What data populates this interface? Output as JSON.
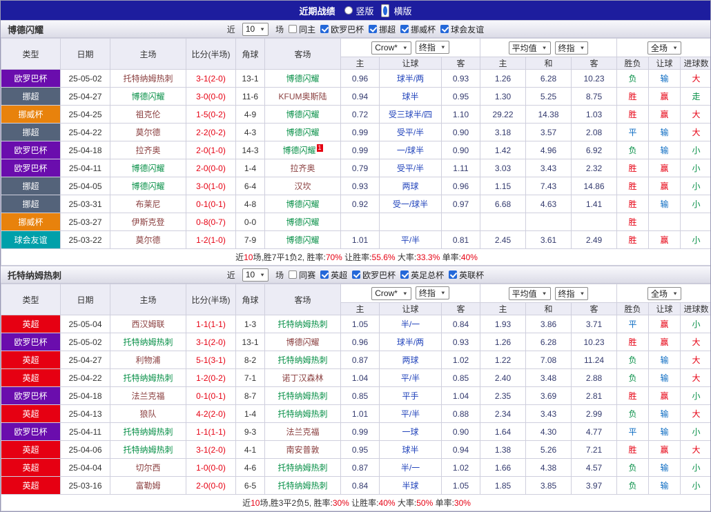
{
  "topbar": {
    "title": "近期战绩",
    "view_options": [
      {
        "label": "竖版",
        "selected": false
      },
      {
        "label": "横版",
        "selected": true
      }
    ]
  },
  "filter_labels": {
    "near": "近",
    "games": "场"
  },
  "table_header": {
    "static_cols": [
      "类型",
      "日期",
      "主场",
      "比分(半场)",
      "角球",
      "客场"
    ],
    "group1": {
      "selects": [
        "Crow*",
        "终指"
      ],
      "cols": [
        "主",
        "让球",
        "客"
      ]
    },
    "group2": {
      "selects": [
        "平均值",
        "终指"
      ],
      "cols": [
        "主",
        "和",
        "客"
      ]
    },
    "group3": {
      "selects": [
        "全场"
      ],
      "cols": [
        "胜负",
        "让球",
        "进球数"
      ]
    }
  },
  "league_colors": {
    "欧罗巴杯": "#6a0dad",
    "挪超": "#54637a",
    "挪威杯": "#e8820c",
    "球会友谊": "#00a0aa",
    "英超": "#e60012"
  },
  "sections": [
    {
      "team": "博德闪耀",
      "filter": {
        "count": "10",
        "same": {
          "label": "同主",
          "checked": false
        },
        "leagues": [
          {
            "label": "欧罗巴杯",
            "checked": true
          },
          {
            "label": "挪超",
            "checked": true
          },
          {
            "label": "挪威杯",
            "checked": true
          },
          {
            "label": "球会友谊",
            "checked": true
          }
        ]
      },
      "rows": [
        {
          "league": "欧罗巴杯",
          "date": "25-05-02",
          "home": {
            "name": "托特纳姆热刺",
            "focus": false
          },
          "score": "3-1(2-0)",
          "corners": "13-1",
          "away": {
            "name": "博德闪耀",
            "focus": true
          },
          "crow": [
            "0.96",
            "球半/两",
            "0.93"
          ],
          "avg": [
            "1.26",
            "6.28",
            "10.23"
          ],
          "outcome": [
            {
              "t": "负",
              "c": "g"
            },
            {
              "t": "输",
              "c": "b"
            },
            {
              "t": "大",
              "c": "r"
            }
          ]
        },
        {
          "league": "挪超",
          "date": "25-04-27",
          "home": {
            "name": "博德闪耀",
            "focus": true
          },
          "score": "3-0(0-0)",
          "corners": "11-6",
          "away": {
            "name": "KFUM奥斯陆",
            "focus": false
          },
          "crow": [
            "0.94",
            "球半",
            "0.95"
          ],
          "avg": [
            "1.30",
            "5.25",
            "8.75"
          ],
          "outcome": [
            {
              "t": "胜",
              "c": "r"
            },
            {
              "t": "赢",
              "c": "r"
            },
            {
              "t": "走",
              "c": "g"
            }
          ]
        },
        {
          "league": "挪威杯",
          "date": "25-04-25",
          "home": {
            "name": "祖克伦",
            "focus": false
          },
          "score": "1-5(0-2)",
          "corners": "4-9",
          "away": {
            "name": "博德闪耀",
            "focus": true
          },
          "crow": [
            "0.72",
            "受三球半/四",
            "1.10"
          ],
          "avg": [
            "29.22",
            "14.38",
            "1.03"
          ],
          "outcome": [
            {
              "t": "胜",
              "c": "r"
            },
            {
              "t": "赢",
              "c": "r"
            },
            {
              "t": "大",
              "c": "r"
            }
          ]
        },
        {
          "league": "挪超",
          "date": "25-04-22",
          "home": {
            "name": "莫尔德",
            "focus": false
          },
          "score": "2-2(0-2)",
          "corners": "4-3",
          "away": {
            "name": "博德闪耀",
            "focus": true
          },
          "crow": [
            "0.99",
            "受平/半",
            "0.90"
          ],
          "avg": [
            "3.18",
            "3.57",
            "2.08"
          ],
          "outcome": [
            {
              "t": "平",
              "c": "b"
            },
            {
              "t": "输",
              "c": "b"
            },
            {
              "t": "大",
              "c": "r"
            }
          ]
        },
        {
          "league": "欧罗巴杯",
          "date": "25-04-18",
          "home": {
            "name": "拉齐奥",
            "focus": false
          },
          "score": "2-0(1-0)",
          "corners": "14-3",
          "away": {
            "name": "博德闪耀",
            "focus": true,
            "badge": "1"
          },
          "crow": [
            "0.99",
            "一/球半",
            "0.90"
          ],
          "avg": [
            "1.42",
            "4.96",
            "6.92"
          ],
          "outcome": [
            {
              "t": "负",
              "c": "g"
            },
            {
              "t": "输",
              "c": "b"
            },
            {
              "t": "小",
              "c": "g"
            }
          ]
        },
        {
          "league": "欧罗巴杯",
          "date": "25-04-11",
          "home": {
            "name": "博德闪耀",
            "focus": true
          },
          "score": "2-0(0-0)",
          "corners": "1-4",
          "away": {
            "name": "拉齐奥",
            "focus": false
          },
          "crow": [
            "0.79",
            "受平/半",
            "1.11"
          ],
          "avg": [
            "3.03",
            "3.43",
            "2.32"
          ],
          "outcome": [
            {
              "t": "胜",
              "c": "r"
            },
            {
              "t": "赢",
              "c": "r"
            },
            {
              "t": "小",
              "c": "g"
            }
          ]
        },
        {
          "league": "挪超",
          "date": "25-04-05",
          "home": {
            "name": "博德闪耀",
            "focus": true
          },
          "score": "3-0(1-0)",
          "corners": "6-4",
          "away": {
            "name": "汉坎",
            "focus": false
          },
          "crow": [
            "0.93",
            "两球",
            "0.96"
          ],
          "avg": [
            "1.15",
            "7.43",
            "14.86"
          ],
          "outcome": [
            {
              "t": "胜",
              "c": "r"
            },
            {
              "t": "赢",
              "c": "r"
            },
            {
              "t": "小",
              "c": "g"
            }
          ]
        },
        {
          "league": "挪超",
          "date": "25-03-31",
          "home": {
            "name": "布莱尼",
            "focus": false
          },
          "score": "0-1(0-1)",
          "corners": "4-8",
          "away": {
            "name": "博德闪耀",
            "focus": true
          },
          "crow": [
            "0.92",
            "受一/球半",
            "0.97"
          ],
          "avg": [
            "6.68",
            "4.63",
            "1.41"
          ],
          "outcome": [
            {
              "t": "胜",
              "c": "r"
            },
            {
              "t": "输",
              "c": "b"
            },
            {
              "t": "小",
              "c": "g"
            }
          ]
        },
        {
          "league": "挪威杯",
          "date": "25-03-27",
          "home": {
            "name": "伊斯克登",
            "focus": false
          },
          "score": "0-8(0-7)",
          "corners": "0-0",
          "away": {
            "name": "博德闪耀",
            "focus": true
          },
          "crow": [
            "",
            "",
            ""
          ],
          "avg": [
            "",
            "",
            ""
          ],
          "outcome": [
            {
              "t": "胜",
              "c": "r"
            },
            {
              "t": "",
              "c": "b"
            },
            {
              "t": "",
              "c": "g"
            }
          ]
        },
        {
          "league": "球会友谊",
          "date": "25-03-22",
          "home": {
            "name": "莫尔德",
            "focus": false
          },
          "score": "1-2(1-0)",
          "corners": "7-9",
          "away": {
            "name": "博德闪耀",
            "focus": true
          },
          "crow": [
            "1.01",
            "平/半",
            "0.81"
          ],
          "avg": [
            "2.45",
            "3.61",
            "2.49"
          ],
          "outcome": [
            {
              "t": "胜",
              "c": "r"
            },
            {
              "t": "赢",
              "c": "r"
            },
            {
              "t": "小",
              "c": "g"
            }
          ]
        }
      ],
      "summary": [
        {
          "t": "近",
          "c": "d"
        },
        {
          "t": "10",
          "c": "r"
        },
        {
          "t": "场,胜7平1负2, 胜率:",
          "c": "d"
        },
        {
          "t": "70%",
          "c": "r"
        },
        {
          "t": " 让胜率:",
          "c": "d"
        },
        {
          "t": "55.6%",
          "c": "r"
        },
        {
          "t": " 大率:",
          "c": "d"
        },
        {
          "t": "33.3%",
          "c": "r"
        },
        {
          "t": " 单率:",
          "c": "d"
        },
        {
          "t": "40%",
          "c": "r"
        }
      ]
    },
    {
      "team": "托特纳姆热刺",
      "filter": {
        "count": "10",
        "same": {
          "label": "同赛",
          "checked": false
        },
        "leagues": [
          {
            "label": "英超",
            "checked": true
          },
          {
            "label": "欧罗巴杯",
            "checked": true
          },
          {
            "label": "英足总杯",
            "checked": true
          },
          {
            "label": "英联杯",
            "checked": true
          }
        ]
      },
      "rows": [
        {
          "league": "英超",
          "date": "25-05-04",
          "home": {
            "name": "西汉姆联",
            "focus": false
          },
          "score": "1-1(1-1)",
          "corners": "1-3",
          "away": {
            "name": "托特纳姆热刺",
            "focus": true
          },
          "crow": [
            "1.05",
            "半/一",
            "0.84"
          ],
          "avg": [
            "1.93",
            "3.86",
            "3.71"
          ],
          "outcome": [
            {
              "t": "平",
              "c": "b"
            },
            {
              "t": "赢",
              "c": "r"
            },
            {
              "t": "小",
              "c": "g"
            }
          ]
        },
        {
          "league": "欧罗巴杯",
          "date": "25-05-02",
          "home": {
            "name": "托特纳姆热刺",
            "focus": true
          },
          "score": "3-1(2-0)",
          "corners": "13-1",
          "away": {
            "name": "博德闪耀",
            "focus": false
          },
          "crow": [
            "0.96",
            "球半/两",
            "0.93"
          ],
          "avg": [
            "1.26",
            "6.28",
            "10.23"
          ],
          "outcome": [
            {
              "t": "胜",
              "c": "r"
            },
            {
              "t": "赢",
              "c": "r"
            },
            {
              "t": "大",
              "c": "r"
            }
          ]
        },
        {
          "league": "英超",
          "date": "25-04-27",
          "home": {
            "name": "利物浦",
            "focus": false
          },
          "score": "5-1(3-1)",
          "corners": "8-2",
          "away": {
            "name": "托特纳姆热刺",
            "focus": true
          },
          "crow": [
            "0.87",
            "两球",
            "1.02"
          ],
          "avg": [
            "1.22",
            "7.08",
            "11.24"
          ],
          "outcome": [
            {
              "t": "负",
              "c": "g"
            },
            {
              "t": "输",
              "c": "b"
            },
            {
              "t": "大",
              "c": "r"
            }
          ]
        },
        {
          "league": "英超",
          "date": "25-04-22",
          "home": {
            "name": "托特纳姆热刺",
            "focus": true
          },
          "score": "1-2(0-2)",
          "corners": "7-1",
          "away": {
            "name": "诺丁汉森林",
            "focus": false
          },
          "crow": [
            "1.04",
            "平/半",
            "0.85"
          ],
          "avg": [
            "2.40",
            "3.48",
            "2.88"
          ],
          "outcome": [
            {
              "t": "负",
              "c": "g"
            },
            {
              "t": "输",
              "c": "b"
            },
            {
              "t": "大",
              "c": "r"
            }
          ]
        },
        {
          "league": "欧罗巴杯",
          "date": "25-04-18",
          "home": {
            "name": "法兰克福",
            "focus": false
          },
          "score": "0-1(0-1)",
          "corners": "8-7",
          "away": {
            "name": "托特纳姆热刺",
            "focus": true
          },
          "crow": [
            "0.85",
            "平手",
            "1.04"
          ],
          "avg": [
            "2.35",
            "3.69",
            "2.81"
          ],
          "outcome": [
            {
              "t": "胜",
              "c": "r"
            },
            {
              "t": "赢",
              "c": "r"
            },
            {
              "t": "小",
              "c": "g"
            }
          ]
        },
        {
          "league": "英超",
          "date": "25-04-13",
          "home": {
            "name": "狼队",
            "focus": false
          },
          "score": "4-2(2-0)",
          "corners": "1-4",
          "away": {
            "name": "托特纳姆热刺",
            "focus": true
          },
          "crow": [
            "1.01",
            "平/半",
            "0.88"
          ],
          "avg": [
            "2.34",
            "3.43",
            "2.99"
          ],
          "outcome": [
            {
              "t": "负",
              "c": "g"
            },
            {
              "t": "输",
              "c": "b"
            },
            {
              "t": "大",
              "c": "r"
            }
          ]
        },
        {
          "league": "欧罗巴杯",
          "date": "25-04-11",
          "home": {
            "name": "托特纳姆热刺",
            "focus": true
          },
          "score": "1-1(1-1)",
          "corners": "9-3",
          "away": {
            "name": "法兰克福",
            "focus": false
          },
          "crow": [
            "0.99",
            "一球",
            "0.90"
          ],
          "avg": [
            "1.64",
            "4.30",
            "4.77"
          ],
          "outcome": [
            {
              "t": "平",
              "c": "b"
            },
            {
              "t": "输",
              "c": "b"
            },
            {
              "t": "小",
              "c": "g"
            }
          ]
        },
        {
          "league": "英超",
          "date": "25-04-06",
          "home": {
            "name": "托特纳姆热刺",
            "focus": true
          },
          "score": "3-1(2-0)",
          "corners": "4-1",
          "away": {
            "name": "南安普敦",
            "focus": false
          },
          "crow": [
            "0.95",
            "球半",
            "0.94"
          ],
          "avg": [
            "1.38",
            "5.26",
            "7.21"
          ],
          "outcome": [
            {
              "t": "胜",
              "c": "r"
            },
            {
              "t": "赢",
              "c": "r"
            },
            {
              "t": "大",
              "c": "r"
            }
          ]
        },
        {
          "league": "英超",
          "date": "25-04-04",
          "home": {
            "name": "切尔西",
            "focus": false
          },
          "score": "1-0(0-0)",
          "corners": "4-6",
          "away": {
            "name": "托特纳姆热刺",
            "focus": true
          },
          "crow": [
            "0.87",
            "半/一",
            "1.02"
          ],
          "avg": [
            "1.66",
            "4.38",
            "4.57"
          ],
          "outcome": [
            {
              "t": "负",
              "c": "g"
            },
            {
              "t": "输",
              "c": "b"
            },
            {
              "t": "小",
              "c": "g"
            }
          ]
        },
        {
          "league": "英超",
          "date": "25-03-16",
          "home": {
            "name": "富勒姆",
            "focus": false
          },
          "score": "2-0(0-0)",
          "corners": "6-5",
          "away": {
            "name": "托特纳姆热刺",
            "focus": true
          },
          "crow": [
            "0.84",
            "半球",
            "1.05"
          ],
          "avg": [
            "1.85",
            "3.85",
            "3.97"
          ],
          "outcome": [
            {
              "t": "负",
              "c": "g"
            },
            {
              "t": "输",
              "c": "b"
            },
            {
              "t": "小",
              "c": "g"
            }
          ]
        }
      ],
      "summary": [
        {
          "t": "近",
          "c": "d"
        },
        {
          "t": "10",
          "c": "r"
        },
        {
          "t": "场,胜3平2负5, 胜率:",
          "c": "d"
        },
        {
          "t": "30%",
          "c": "r"
        },
        {
          "t": " 让胜率:",
          "c": "d"
        },
        {
          "t": "40%",
          "c": "r"
        },
        {
          "t": " 大率:",
          "c": "d"
        },
        {
          "t": "50%",
          "c": "r"
        },
        {
          "t": " 单率:",
          "c": "d"
        },
        {
          "t": "30%",
          "c": "r"
        }
      ]
    }
  ]
}
